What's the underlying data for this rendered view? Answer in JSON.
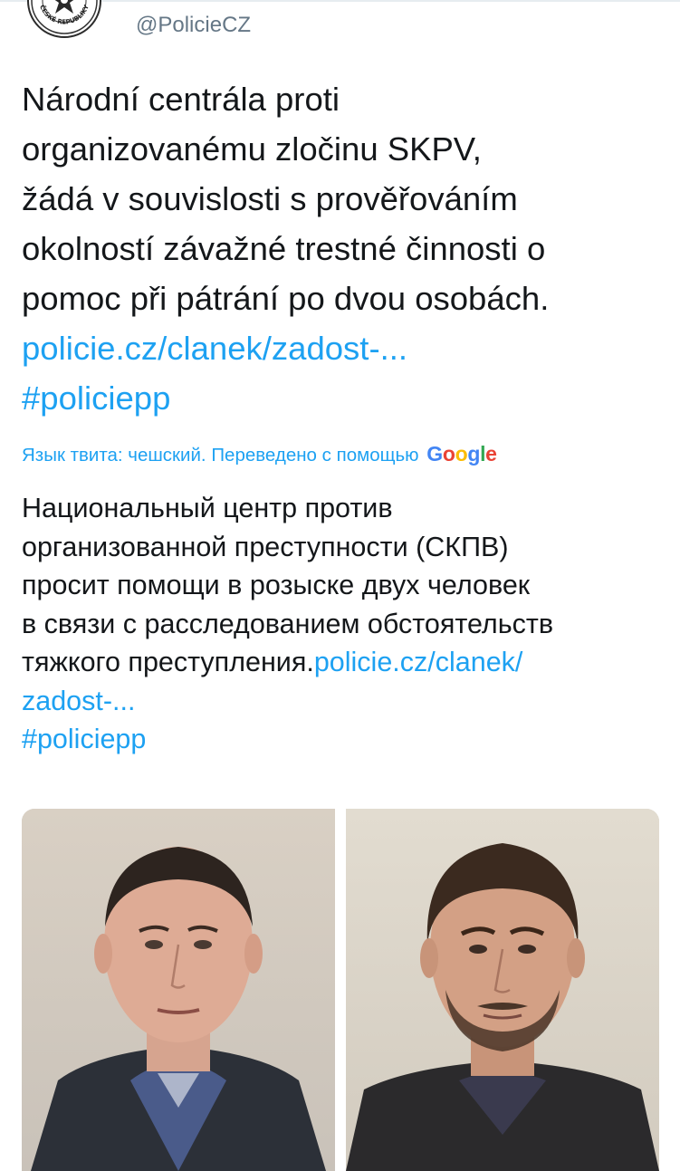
{
  "tweet": {
    "handle": "@PolicieCZ",
    "avatar_icon": "police-badge-icon",
    "avatar_text": "ČESKÉ REPUBLIKY",
    "text_lines": [
      "Národní centrála proti",
      "organizovanému zločinu SKPV,",
      "žádá v souvislosti s prověřováním",
      "okolností závažné trestné činnosti o",
      "pomoc při pátrání po dvou osobách."
    ],
    "link": "policie.cz/clanek/zadost-...",
    "hashtag": "#policiepp"
  },
  "translation": {
    "info_label": "Язык твита: чешский. Переведено с помощью",
    "provider_letters": [
      "G",
      "o",
      "o",
      "g",
      "l",
      "e"
    ],
    "text_lines": [
      "Национальный центр против",
      "организованной преступности (СКПВ)",
      "просит помощи в розыске двух человек",
      "в связи с расследованием обстоятельств"
    ],
    "last_line_text": "тяжкого преступления.",
    "link_part1": "policie.cz/clanek/",
    "link_part2": "zadost-...",
    "hashtag": "#policiepp"
  },
  "media": {
    "photo_count": 2
  },
  "colors": {
    "link": "#1da1f2",
    "text": "#14171a",
    "handle": "#657786",
    "google_blue": "#4285f4",
    "google_red": "#ea4335",
    "google_yellow": "#fbbc05",
    "google_green": "#34a853"
  }
}
